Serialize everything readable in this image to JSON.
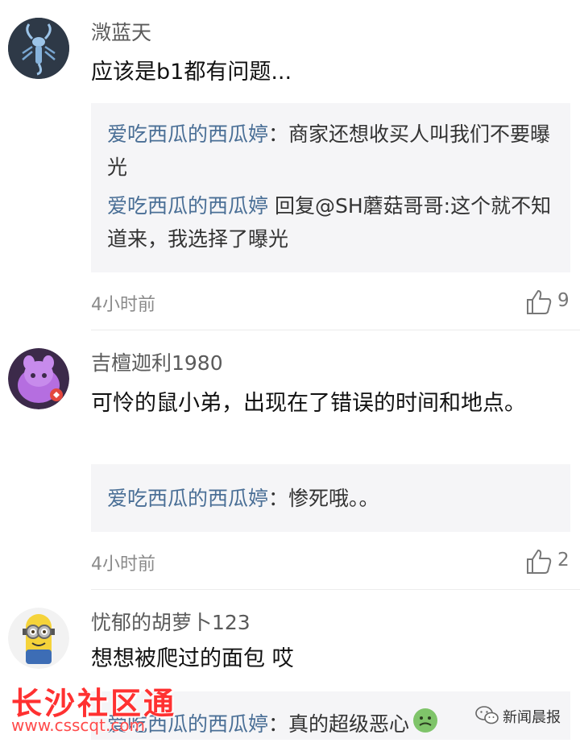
{
  "comments": [
    {
      "username": "溦蓝天",
      "text": "应该是b1都有问题...",
      "avatar_icon": "scorpion-avatar",
      "replies": [
        {
          "name": "爱吃西瓜的西瓜婷",
          "sep": "：",
          "text": "商家还想收买人叫我们不要曝光"
        },
        {
          "name": "爱吃西瓜的西瓜婷",
          "sep": " 回复@SH蘑菇哥哥:",
          "text": "这个就不知道来，我选择了曝光"
        }
      ],
      "time": "4小时前",
      "likes": "9"
    },
    {
      "username": "吉檀迦利1980",
      "text": "可怜的鼠小弟，出现在了错误的时间和地点。",
      "avatar_icon": "purple-cartoon-avatar",
      "replies": [
        {
          "name": "爱吃西瓜的西瓜婷",
          "sep": "：",
          "text": "惨死哦。。"
        }
      ],
      "time": "4小时前",
      "likes": "2"
    },
    {
      "username": "忧郁的胡萝卜123",
      "text": "想想被爬过的面包 哎",
      "avatar_icon": "minion-avatar",
      "replies": [
        {
          "name": "爱吃西瓜的西瓜婷",
          "sep": "：",
          "text": "真的超级恶心"
        }
      ]
    }
  ],
  "watermarks": {
    "site_name": "长沙社区通",
    "site_url": "www.csscqt.com",
    "source": "新闻晨报"
  }
}
